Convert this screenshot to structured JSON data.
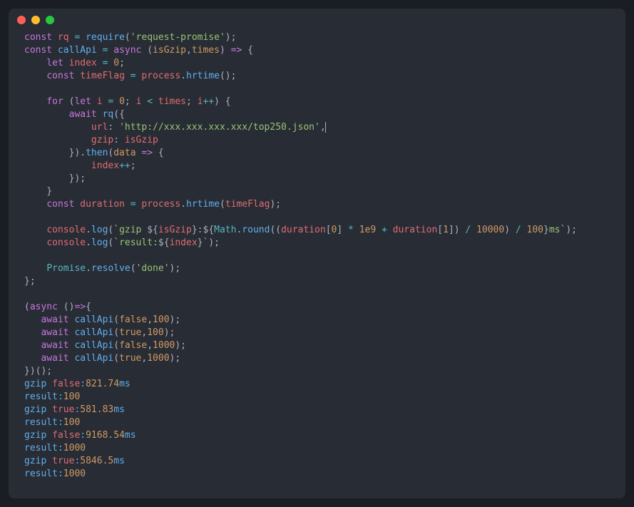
{
  "code": {
    "l1": {
      "const": "const",
      "rq": "rq",
      "eq": "=",
      "require": "require",
      "str": "'request-promise'"
    },
    "l2": {
      "const": "const",
      "callApi": "callApi",
      "eq": "=",
      "async": "async",
      "isGzip": "isGzip",
      "times": "times",
      "arrow": "=>"
    },
    "l3": {
      "let": "let",
      "index": "index",
      "eq": "=",
      "zero": "0"
    },
    "l4": {
      "const": "const",
      "timeFlag": "timeFlag",
      "eq": "=",
      "process": "process",
      "hrtime": "hrtime"
    },
    "l6": {
      "for": "for",
      "let": "let",
      "i": "i",
      "eq": "=",
      "zero": "0",
      "lt": "<",
      "times": "times",
      "inc": "++"
    },
    "l7": {
      "await": "await",
      "rq": "rq"
    },
    "l8": {
      "url": "url",
      "str": "'http://xxx.xxx.xxx.xxx/top250.json'"
    },
    "l9": {
      "gzip": "gzip",
      "isGzip": "isGzip"
    },
    "l10": {
      "then": "then",
      "data": "data",
      "arrow": "=>"
    },
    "l11": {
      "index": "index",
      "inc": "++"
    },
    "l14": {
      "const": "const",
      "duration": "duration",
      "eq": "=",
      "process": "process",
      "hrtime": "hrtime",
      "timeFlag": "timeFlag"
    },
    "l16": {
      "console": "console",
      "log": "log",
      "tpl1": "`gzip ",
      "isGzip": "isGzip",
      "colon": ":",
      "Math": "Math",
      "round": "round",
      "duration": "duration",
      "n0": "0",
      "mul": "*",
      "e9": "1e9",
      "plus": "+",
      "n1": "1",
      "div": "/",
      "n10000": "10000",
      "n100": "100",
      "ms": "ms`"
    },
    "l17": {
      "console": "console",
      "log": "log",
      "tpl": "`result:",
      "index": "index",
      "end": "`"
    },
    "l19": {
      "Promise": "Promise",
      "resolve": "resolve",
      "str": "'done'"
    },
    "l22": {
      "async": "async",
      "arrow": "=>"
    },
    "l23": {
      "await": "await",
      "callApi": "callApi",
      "false": "false",
      "n": "100"
    },
    "l24": {
      "await": "await",
      "callApi": "callApi",
      "true": "true",
      "n": "100"
    },
    "l25": {
      "await": "await",
      "callApi": "callApi",
      "false": "false",
      "n": "1000"
    },
    "l26": {
      "await": "await",
      "callApi": "callApi",
      "true": "true",
      "n": "1000"
    }
  },
  "output": {
    "o1": {
      "pre": "gzip ",
      "val": "false",
      "sep": ":",
      "time": "821.74",
      "ms": "ms"
    },
    "o2": {
      "pre": "result:",
      "val": "100"
    },
    "o3": {
      "pre": "gzip ",
      "val": "true",
      "sep": ":",
      "time": "581.83",
      "ms": "ms"
    },
    "o4": {
      "pre": "result:",
      "val": "100"
    },
    "o5": {
      "pre": "gzip ",
      "val": "false",
      "sep": ":",
      "time": "9168.54",
      "ms": "ms"
    },
    "o6": {
      "pre": "result:",
      "val": "1000"
    },
    "o7": {
      "pre": "gzip ",
      "val": "true",
      "sep": ":",
      "time": "5846.5",
      "ms": "ms"
    },
    "o8": {
      "pre": "result:",
      "val": "1000"
    }
  }
}
